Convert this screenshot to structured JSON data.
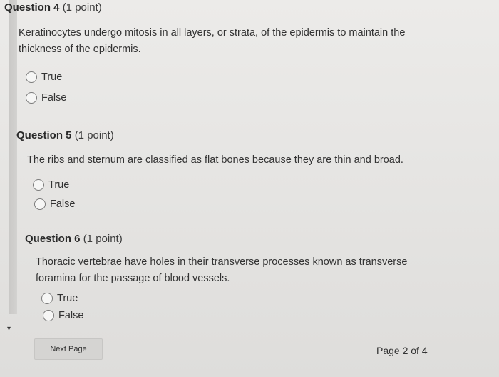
{
  "questions": [
    {
      "title": "Question 4",
      "points": "(1 point)",
      "text_lines": [
        "Keratinocytes undergo mitosis in all layers, or strata, of the epidermis to maintain the",
        "thickness of the epidermis."
      ],
      "options": [
        "True",
        "False"
      ]
    },
    {
      "title": "Question 5",
      "points": "(1 point)",
      "text_lines": [
        "The ribs and sternum are classified as flat bones because they are thin and broad."
      ],
      "options": [
        "True",
        "False"
      ]
    },
    {
      "title": "Question 6",
      "points": "(1 point)",
      "text_lines": [
        "Thoracic vertebrae have holes in their transverse processes known as transverse",
        "foramina for the passage of blood vessels."
      ],
      "options": [
        "True",
        "False"
      ]
    }
  ],
  "footer": {
    "next_label": "Next Page",
    "page_indicator": "Page 2 of 4"
  }
}
